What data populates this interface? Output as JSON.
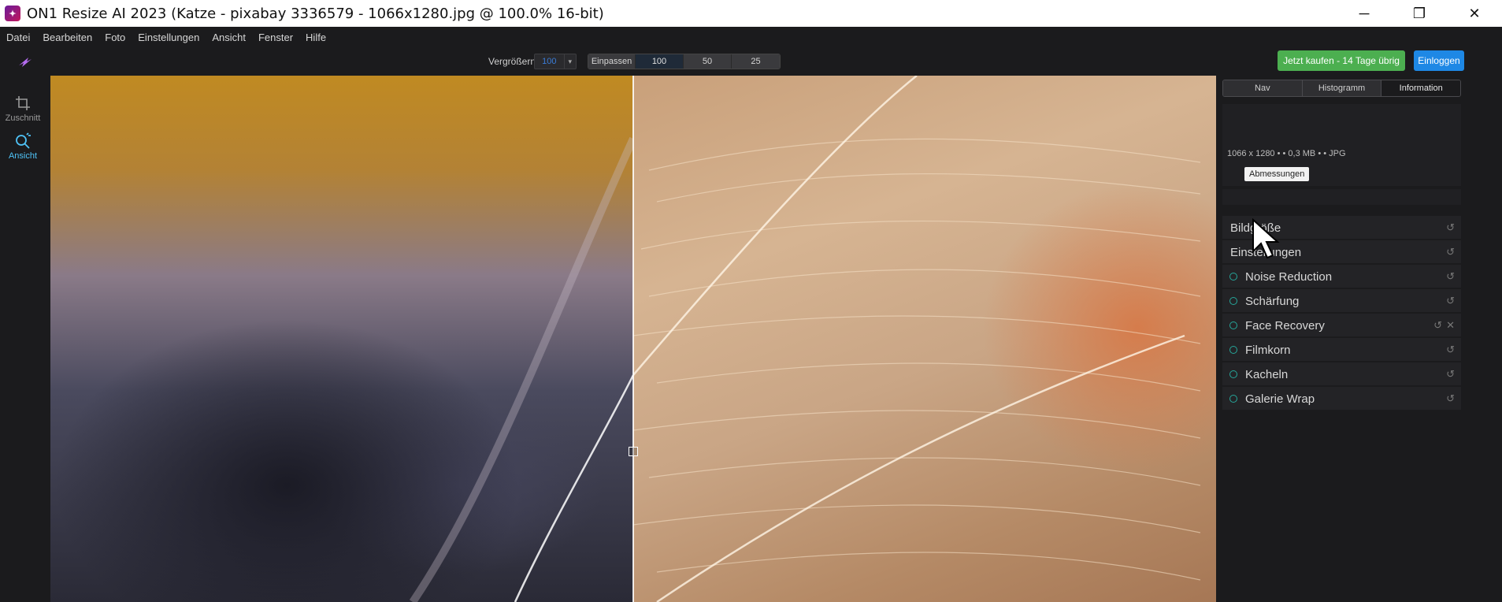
{
  "window": {
    "title": "ON1 Resize AI 2023 (Katze - pixabay 3336579 - 1066x1280.jpg @ 100.0% 16-bit)",
    "controls": [
      "minimize-icon",
      "restore-icon",
      "close-icon"
    ]
  },
  "menu": {
    "items": [
      "Datei",
      "Bearbeiten",
      "Foto",
      "Einstellungen",
      "Ansicht",
      "Fenster",
      "Hilfe"
    ]
  },
  "toolbar": {
    "zoom_label": "Vergrößern",
    "zoom_value": "100",
    "zoom_options": [
      "Einpassen",
      "100",
      "50",
      "25"
    ],
    "zoom_active": "100",
    "buy_label": "Jetzt kaufen - 14 Tage übrig",
    "login_label": "Einloggen",
    "colors": {
      "buy": "#4caf50",
      "login": "#1e88e5"
    }
  },
  "tools": [
    {
      "label": "Zuschnitt",
      "icon": "crop-icon"
    },
    {
      "label": "Ansicht",
      "icon": "view-icon",
      "active": true
    }
  ],
  "panel": {
    "tabs": [
      "Nav",
      "Histogramm",
      "Information"
    ],
    "active_tab": "Information",
    "info_line": "1066 x 1280  • •  0,3 MB  • •  JPG",
    "tooltip": "Abmessungen",
    "sections": [
      {
        "label": "Bildgröße",
        "radio": false,
        "close": false
      },
      {
        "label": "Einstellungen",
        "radio": false,
        "close": false
      },
      {
        "label": "Noise Reduction",
        "radio": true,
        "close": false
      },
      {
        "label": "Schärfung",
        "radio": true,
        "close": false
      },
      {
        "label": "Face Recovery",
        "radio": true,
        "close": true
      },
      {
        "label": "Filmkorn",
        "radio": true,
        "close": false
      },
      {
        "label": "Kacheln",
        "radio": true,
        "close": false
      },
      {
        "label": "Galerie Wrap",
        "radio": true,
        "close": false
      }
    ]
  }
}
